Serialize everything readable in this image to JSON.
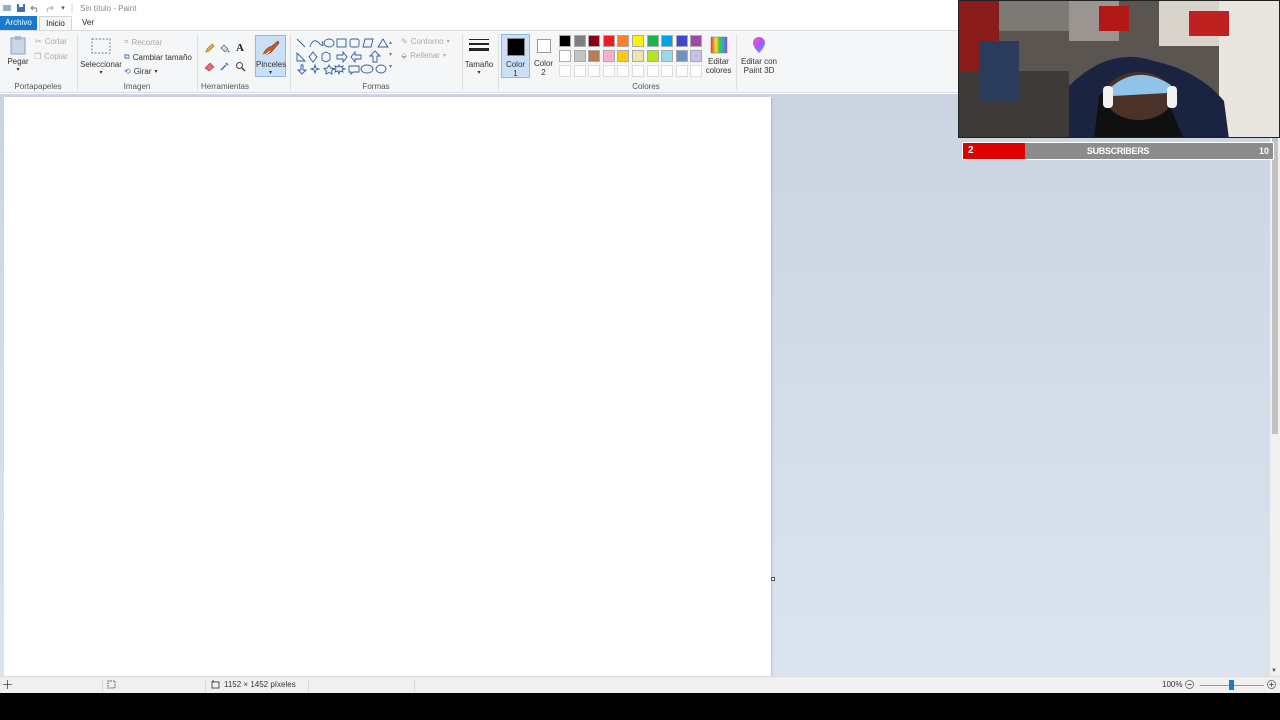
{
  "window": {
    "title": "Sin título - Paint"
  },
  "tabs": [
    {
      "label": "Archivo"
    },
    {
      "label": "Inicio"
    },
    {
      "label": "Ver"
    }
  ],
  "ribbon": {
    "clipboard": {
      "paste": "Pegar",
      "cut": "Cortar",
      "copy": "Copiar",
      "group": "Portapapeles"
    },
    "image": {
      "select": "Seleccionar",
      "crop": "Recortar",
      "resize": "Cambiar tamaño",
      "rotate": "Girar",
      "group": "Imagen"
    },
    "tools": {
      "group": "Herramientas",
      "brushes": "Pinceles"
    },
    "shapes": {
      "outline": "Contorno",
      "fill": "Rellenar",
      "group": "Formas"
    },
    "size": {
      "label": "Tamaño"
    },
    "color1": {
      "label": "Color",
      "num": "1"
    },
    "color2": {
      "label": "Color",
      "num": "2"
    },
    "colors": {
      "group": "Colores",
      "row1": [
        "#000000",
        "#7f7f7f",
        "#880015",
        "#ed1c24",
        "#ff7f27",
        "#fff200",
        "#22b14c",
        "#00a2e8",
        "#3f48cc",
        "#a349a4"
      ],
      "row2": [
        "#ffffff",
        "#c3c3c3",
        "#b97a57",
        "#ffaec9",
        "#ffc90e",
        "#efe4b0",
        "#b5e61d",
        "#99d9ea",
        "#7092be",
        "#c8bfe7"
      ]
    },
    "edit_colors": {
      "line1": "Editar",
      "line2": "colores"
    },
    "paint3d": {
      "line1": "Editar con",
      "line2": "Paint 3D"
    }
  },
  "status": {
    "dimensions": "1152 × 1452 píxeles",
    "zoom": "100%"
  },
  "overlay": {
    "subscribers_label": "SUBSCRIBERS",
    "current": "2",
    "goal": "10",
    "progress": 0.2
  }
}
